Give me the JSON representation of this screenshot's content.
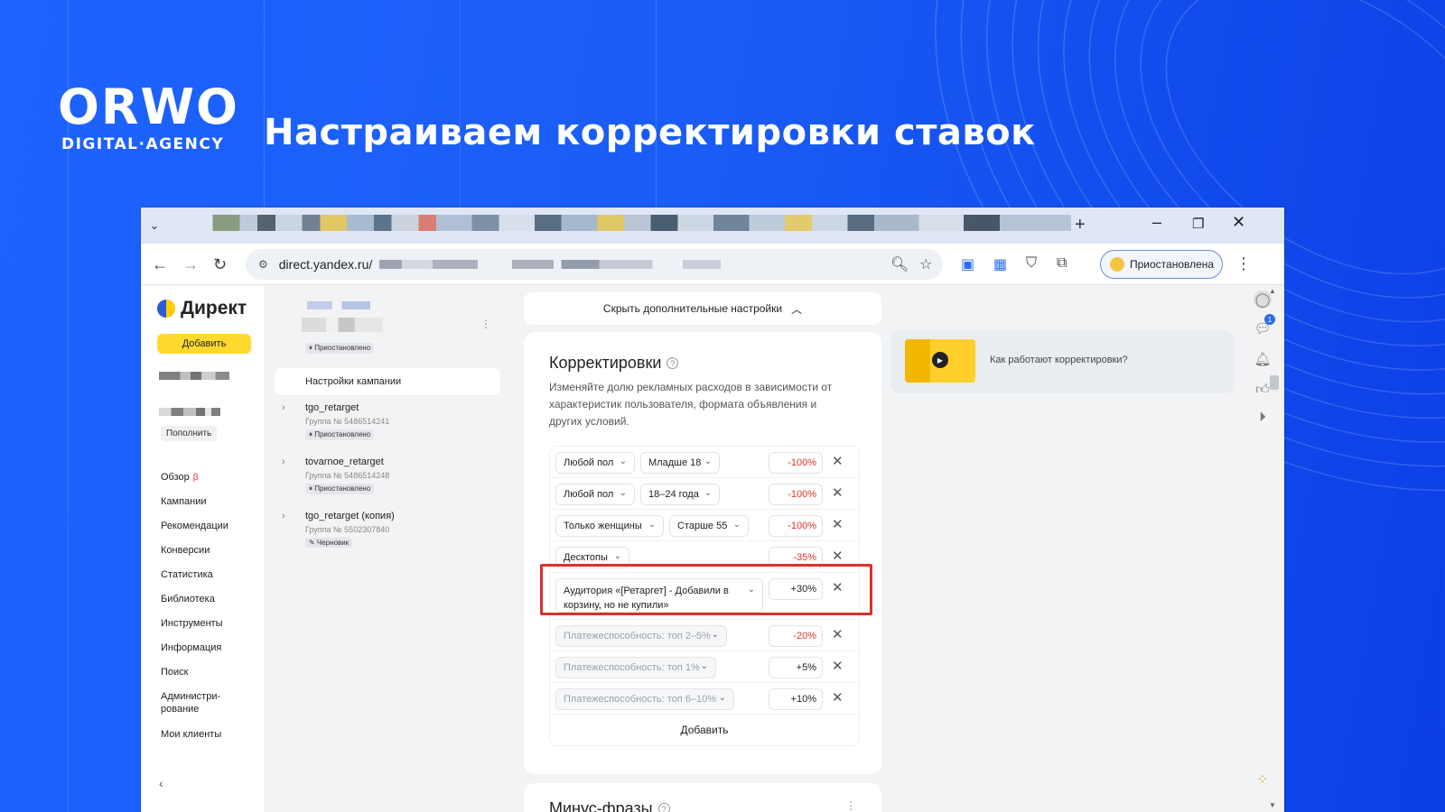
{
  "brand": {
    "logo": "ORWO",
    "tagline": "DIGITAL·AGENCY"
  },
  "headline": "Настраиваем корректировки ставок",
  "browser": {
    "url": "direct.yandex.ru/",
    "profile_status": "Приостановлена"
  },
  "sidebar": {
    "app_name": "Директ",
    "add_label": "Добавить",
    "topup_label": "Пополнить",
    "nav": [
      {
        "label": "Обзор",
        "beta": "β"
      },
      {
        "label": "Кампании"
      },
      {
        "label": "Рекомендации"
      },
      {
        "label": "Конверсии"
      },
      {
        "label": "Статистика"
      },
      {
        "label": "Библиотека"
      },
      {
        "label": "Инструменты"
      },
      {
        "label": "Информация"
      },
      {
        "label": "Поиск"
      },
      {
        "label": "Администри-рование"
      },
      {
        "label": "Мои клиенты"
      }
    ]
  },
  "campaign": {
    "status": "⏸ Приостановлено",
    "settings_label": "Настройки кампании",
    "groups": [
      {
        "name": "tgo_retarget",
        "number": "Группа № 5486514241",
        "status": "⏸ Приостановлено"
      },
      {
        "name": "tovarnoe_retarget",
        "number": "Группа № 5486514248",
        "status": "⏸ Приостановлено"
      },
      {
        "name": "tgo_retarget (копия)",
        "number": "Группа № 5502307840",
        "status": "✎ Черновик"
      }
    ]
  },
  "main": {
    "hide_settings_label": "Скрыть дополнительные настройки",
    "adjustments_title": "Корректировки",
    "adjustments_desc": "Изменяйте долю рекламных расходов в зависимости от характеристик пользователя, формата объявления и других условий.",
    "rows": [
      {
        "sel1": "Любой пол",
        "sel2": "Младше 18",
        "value": "-100%"
      },
      {
        "sel1": "Любой пол",
        "sel2": "18–24 года",
        "value": "-100%"
      },
      {
        "sel1": "Только женщины",
        "sel2": "Старше 55",
        "value": "-100%"
      },
      {
        "sel1": "Десктопы",
        "value": "-35%"
      },
      {
        "sel1": "Аудитория «[Ретаргет] - Добавили в корзину, но не купили»",
        "value": "+30%"
      },
      {
        "sel1": "Платежеспособность: топ 2–5%",
        "value": "-20%"
      },
      {
        "sel1": "Платежеспособность: топ 1%",
        "value": "+5%"
      },
      {
        "sel1": "Платежеспособность: топ 6–10%",
        "value": "+10%"
      }
    ],
    "add_label": "Добавить",
    "minus_title": "Минус-фразы"
  },
  "video": {
    "label": "Как работают корректировки?"
  },
  "rail": {
    "badge_count": "1"
  },
  "colors": {
    "background": "#1e63ff",
    "highlight": "#d9312e",
    "negative": "#e0332b",
    "accent": "#ffd92e"
  }
}
